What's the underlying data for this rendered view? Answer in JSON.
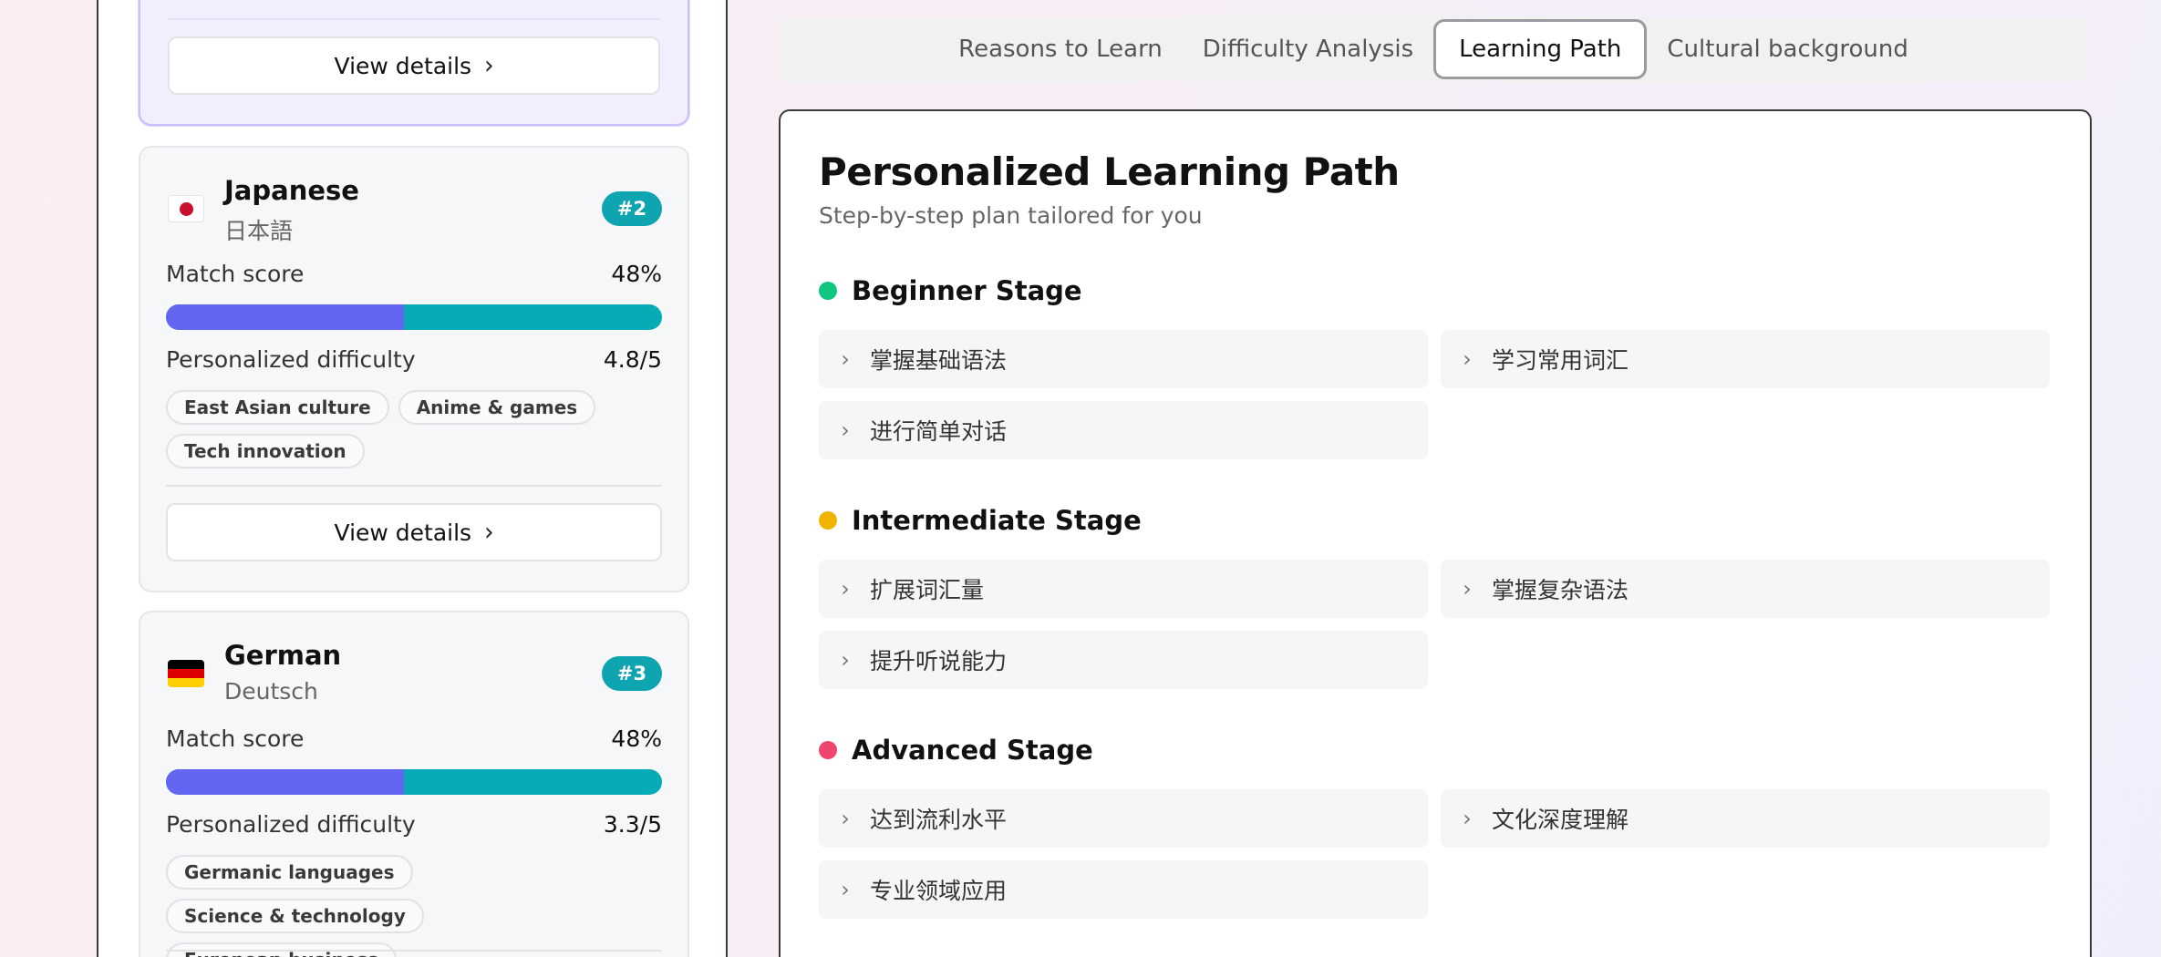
{
  "left": {
    "top_card": {
      "button_label": "View details"
    },
    "languages": [
      {
        "name": "Japanese",
        "native": "日本語",
        "rank": "#2",
        "flag": "japan-flag-icon",
        "match_label": "Match score",
        "match_value": "48%",
        "match_fraction": 0.48,
        "difficulty_label": "Personalized difficulty",
        "difficulty_value": "4.8/5",
        "tags": [
          "East Asian culture",
          "Anime & games",
          "Tech innovation"
        ],
        "button_label": "View details"
      },
      {
        "name": "German",
        "native": "Deutsch",
        "rank": "#3",
        "flag": "germany-flag-icon",
        "match_label": "Match score",
        "match_value": "48%",
        "match_fraction": 0.48,
        "difficulty_label": "Personalized difficulty",
        "difficulty_value": "3.3/5",
        "tags": [
          "Germanic languages",
          "Science & technology",
          "European business"
        ]
      }
    ]
  },
  "tabs": [
    {
      "label": "Reasons to Learn",
      "active": false
    },
    {
      "label": "Difficulty Analysis",
      "active": false
    },
    {
      "label": "Learning Path",
      "active": true
    },
    {
      "label": "Cultural background",
      "active": false
    }
  ],
  "content": {
    "title": "Personalized Learning Path",
    "subtitle": "Step-by-step plan tailored for you",
    "stages": [
      {
        "name": "Beginner Stage",
        "color": "#10c57f",
        "items": [
          "掌握基础语法",
          "学习常用词汇",
          "进行简单对话"
        ]
      },
      {
        "name": "Intermediate Stage",
        "color": "#f0b400",
        "items": [
          "扩展词汇量",
          "掌握复杂语法",
          "提升听说能力"
        ]
      },
      {
        "name": "Advanced Stage",
        "color": "#f0456f",
        "items": [
          "达到流利水平",
          "文化深度理解",
          "专业领域应用"
        ]
      }
    ]
  },
  "colors": {
    "accent_indigo": "#6366f1",
    "accent_teal": "#06abb5",
    "selected_card_bg": "#f2eefe"
  }
}
